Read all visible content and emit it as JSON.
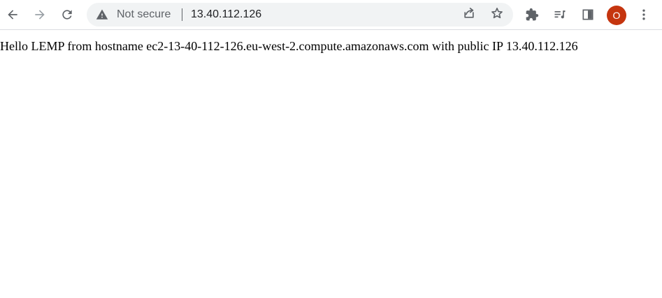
{
  "browser": {
    "nav": {
      "back_icon": "arrow-left-icon",
      "forward_icon": "arrow-right-icon",
      "reload_icon": "reload-icon"
    },
    "omnibox": {
      "security_icon": "warning-triangle-icon",
      "security_label": "Not secure",
      "url": "13.40.112.126",
      "share_icon": "share-icon",
      "bookmark_icon": "star-icon"
    },
    "actions": {
      "extensions_icon": "puzzle-icon",
      "media_icon": "media-queue-icon",
      "side_panel_icon": "side-panel-icon",
      "menu_icon": "kebab-menu-icon"
    },
    "profile": {
      "initial": "O",
      "color": "#c5350f"
    }
  },
  "page": {
    "body_text": "Hello LEMP from hostname ec2-13-40-112-126.eu-west-2.compute.amazonaws.com with public IP 13.40.112.126"
  },
  "colors": {
    "icon": "#5f6368",
    "icon_disabled": "#9aa0a6",
    "omnibox_bg": "#f1f3f4",
    "text": "#000000"
  }
}
